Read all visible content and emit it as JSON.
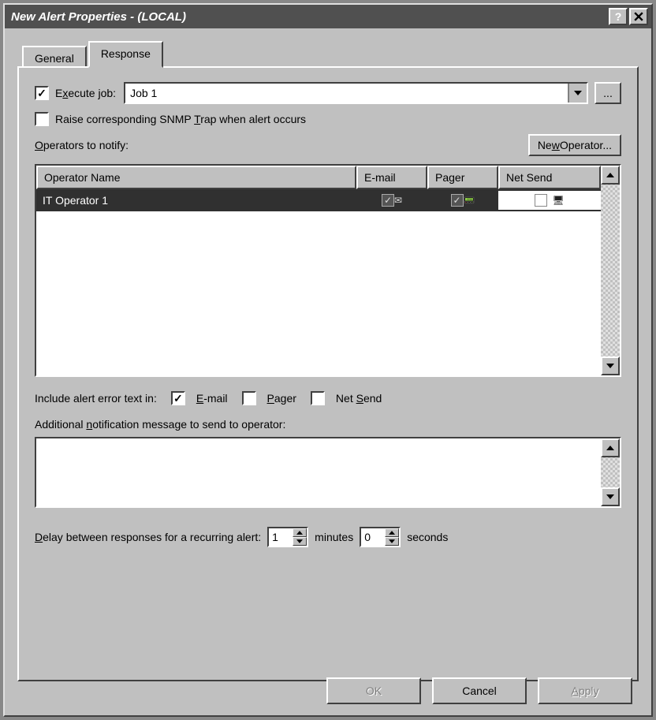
{
  "window": {
    "title": "New Alert Properties - (LOCAL)"
  },
  "tabs": {
    "general": "General",
    "response": "Response"
  },
  "execJob": {
    "label_pre": "E",
    "label_u": "x",
    "label_post": "ecute job:",
    "checked": true,
    "value": "Job 1",
    "browse": "..."
  },
  "snmp": {
    "checked": false,
    "label_pre": "Raise corresponding SNMP ",
    "label_u": "T",
    "label_post": "rap when alert occurs"
  },
  "operators": {
    "label_u": "O",
    "label_post": "perators to notify:",
    "newBtn_pre": "Ne",
    "newBtn_u": "w",
    "newBtn_post": " Operator...",
    "columns": {
      "name": "Operator Name",
      "email": "E-mail",
      "pager": "Pager",
      "netsend": "Net Send"
    },
    "rows": [
      {
        "name": "IT Operator 1",
        "email": true,
        "pager": true,
        "netsend": false
      }
    ]
  },
  "include": {
    "label": "Include alert error text in:",
    "email_u": "E",
    "email_post": "-mail",
    "email_checked": true,
    "pager_u": "P",
    "pager_post": "ager",
    "pager_checked": false,
    "net_pre": "Net ",
    "net_u": "S",
    "net_post": "end",
    "net_checked": false
  },
  "addMsg": {
    "label_pre": "Additional ",
    "label_u": "n",
    "label_post": "otification message to send to operator:",
    "value": ""
  },
  "delay": {
    "label_u": "D",
    "label_post": "elay between responses for a recurring alert:",
    "minutes": "1",
    "minutes_label": "minutes",
    "seconds": "0",
    "seconds_label": "seconds"
  },
  "buttons": {
    "ok": "OK",
    "cancel": "Cancel",
    "apply_u": "A",
    "apply_post": "pply"
  }
}
